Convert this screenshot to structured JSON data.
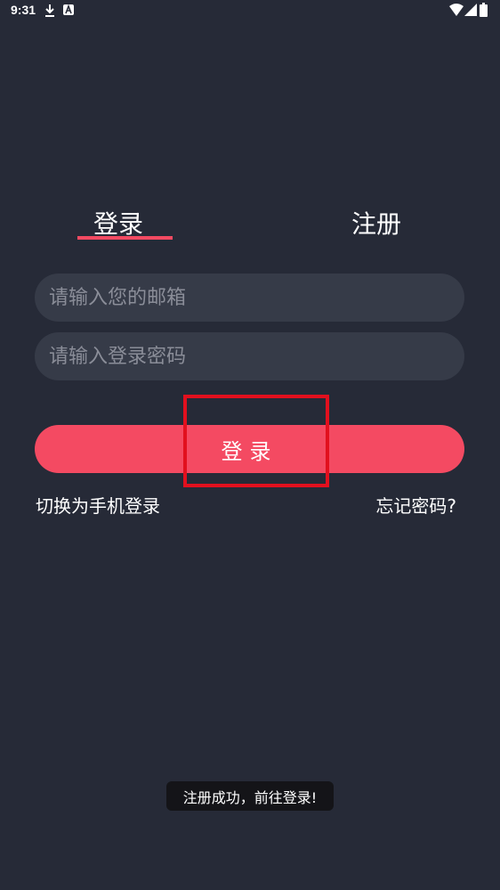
{
  "status_bar": {
    "time": "9:31",
    "icons": [
      "download-icon",
      "app-notification-icon",
      "wifi-icon",
      "signal-icon",
      "battery-icon"
    ]
  },
  "tabs": {
    "login_label": "登录",
    "register_label": "注册",
    "active": "login",
    "accent_color": "#f44a62"
  },
  "form": {
    "email_placeholder": "请输入您的邮箱",
    "password_placeholder": "请输入登录密码",
    "login_button_label": "登录"
  },
  "links": {
    "phone_login": "切换为手机登录",
    "forgot_password": "忘记密码?"
  },
  "toast": {
    "message": "注册成功，前往登录!"
  },
  "colors": {
    "background": "#262a37",
    "input_background": "#363b48",
    "primary": "#f44a62",
    "highlight_box": "#e2101e"
  }
}
